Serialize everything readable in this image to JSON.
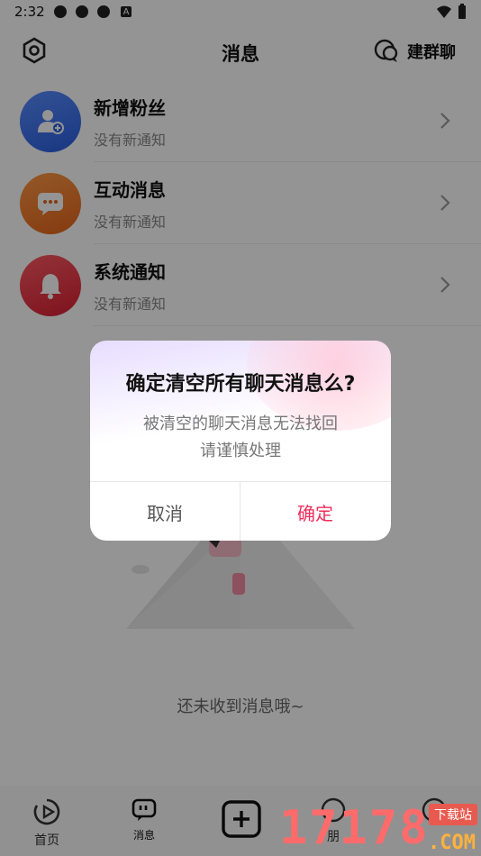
{
  "status": {
    "time": "2:32",
    "icons": [
      "notify-icon",
      "notify-icon",
      "notify-icon",
      "a-icon",
      "wifi-icon",
      "battery-icon"
    ]
  },
  "header": {
    "title": "消息",
    "settings_icon": "settings-icon",
    "group_label": "建群聊",
    "group_icon": "chat-bubble-icon"
  },
  "messages": [
    {
      "title": "新增粉丝",
      "subtitle": "没有新通知",
      "icon": "add-user-icon",
      "color": "#2f6ef0"
    },
    {
      "title": "互动消息",
      "subtitle": "没有新通知",
      "icon": "chat-dots-icon",
      "color": "#f07a2a"
    },
    {
      "title": "系统通知",
      "subtitle": "没有新通知",
      "icon": "bell-icon",
      "color": "#ea3547"
    }
  ],
  "empty": {
    "text": "还未收到消息哦~"
  },
  "dialog": {
    "title": "确定清空所有聊天消息么?",
    "message_line1": "被清空的聊天消息无法找回",
    "message_line2": "请谨慎处理",
    "cancel": "取消",
    "confirm": "确定",
    "confirm_color": "#ee2e5c"
  },
  "nav": {
    "home": "首页",
    "messages": "消息",
    "post_icon": "plus-square-icon",
    "hidden_label": "朋"
  },
  "watermark": {
    "number": "17178",
    "tag": "下载站",
    "domain": ".COM"
  }
}
